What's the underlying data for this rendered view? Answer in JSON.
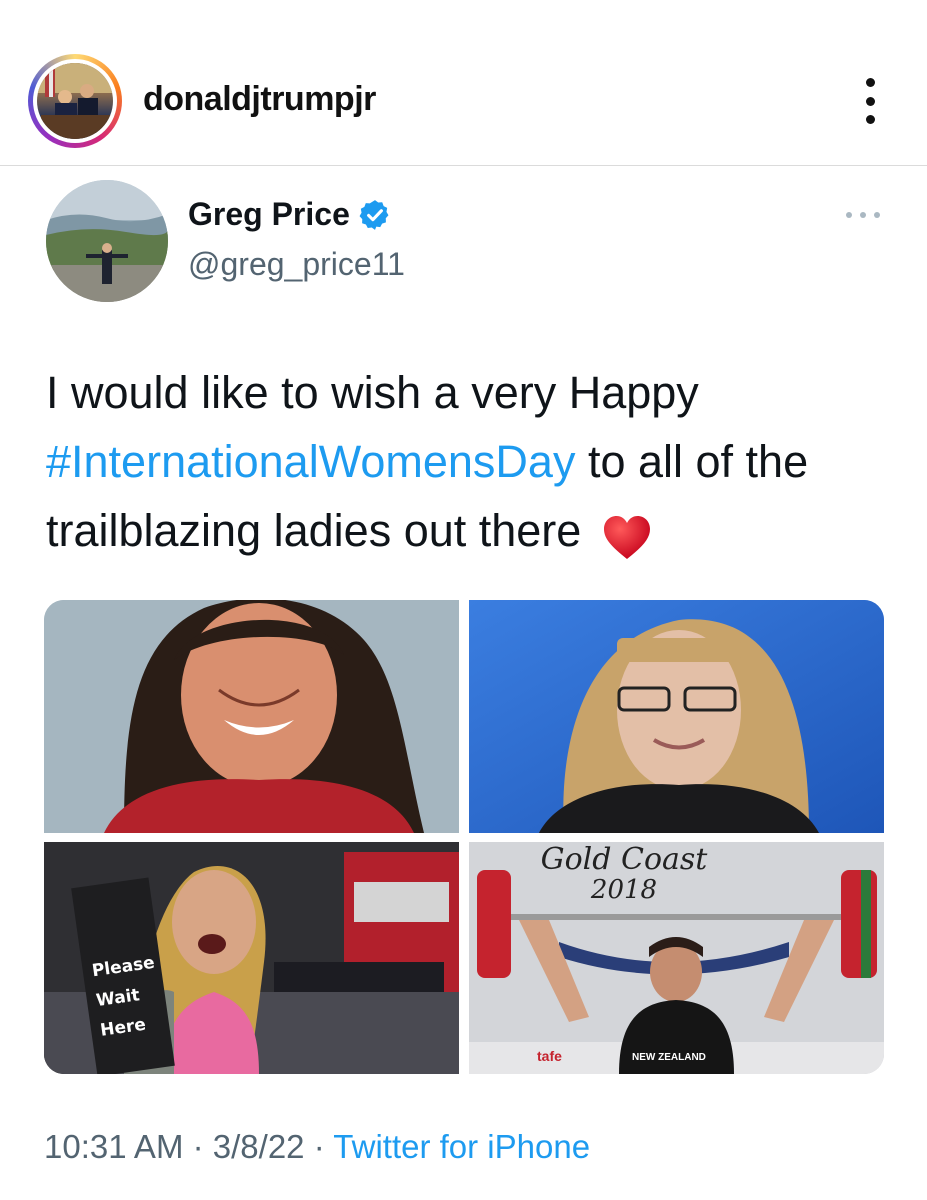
{
  "instagram": {
    "username": "donaldjtrumpjr",
    "avatar_icon": "profile-photo",
    "more_icon": "vertical-ellipsis-icon"
  },
  "tweet": {
    "display_name": "Greg Price",
    "handle": "@greg_price11",
    "verified_icon": "verified-badge-icon",
    "verified_color": "#1d9bf0",
    "text_part1": "I would like to wish a very Happy",
    "hashtag": "#InternationalWomensDay",
    "text_part2": " to all of the trailblazing ladies out there ",
    "emoji": "red-heart-emoji",
    "media": {
      "photo3_sign_lines": [
        "Please",
        "Wait",
        "Here"
      ],
      "photo4_banner_line1": "Gold Coast",
      "photo4_banner_line2": "2018",
      "photo4_shirt_text": "NEW ZEALAND",
      "photo4_sponsor": "tafe"
    },
    "time": "10:31 AM",
    "date": "3/8/22",
    "separator": "·",
    "source": "Twitter for iPhone",
    "hashtag_color": "#1d9bf0"
  }
}
